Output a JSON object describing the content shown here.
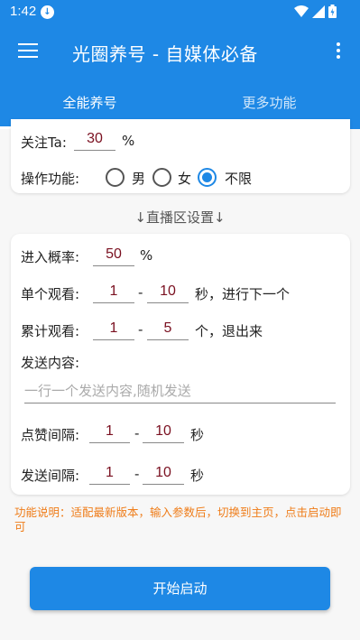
{
  "status_bar": {
    "time": "1:42"
  },
  "app_bar": {
    "title": "光圈养号 - 自媒体必备"
  },
  "tabs": [
    {
      "label": "全能养号"
    },
    {
      "label": "更多功能"
    }
  ],
  "follow": {
    "label": "关注Ta:",
    "value": "30",
    "unit": "%"
  },
  "operation": {
    "label": "操作功能:",
    "options": [
      {
        "label": "男"
      },
      {
        "label": "女"
      },
      {
        "label": "不限"
      }
    ],
    "selected": "不限"
  },
  "section_title": "↓直播区设置↓",
  "enter_prob": {
    "label": "进入概率:",
    "value": "50",
    "unit": "%"
  },
  "single_watch": {
    "label": "单个观看:",
    "min": "1",
    "max": "10",
    "suffix": "秒，进行下一个"
  },
  "total_watch": {
    "label": "累计观看:",
    "min": "1",
    "max": "5",
    "suffix": "个，退出来"
  },
  "send_content": {
    "label": "发送内容:",
    "placeholder": "一行一个发送内容,随机发送"
  },
  "like_interval": {
    "label": "点赞间隔:",
    "min": "1",
    "max": "10",
    "suffix": "秒"
  },
  "send_interval": {
    "label": "发送间隔:",
    "min": "1",
    "max": "10",
    "suffix": "秒"
  },
  "note": "功能说明：适配最新版本，输入参数后，切换到主页，点击启动即可",
  "start_button": "开始启动",
  "colors": {
    "primary": "#1e88e5",
    "note": "#ef7d1a",
    "input_value": "#7a1020"
  }
}
